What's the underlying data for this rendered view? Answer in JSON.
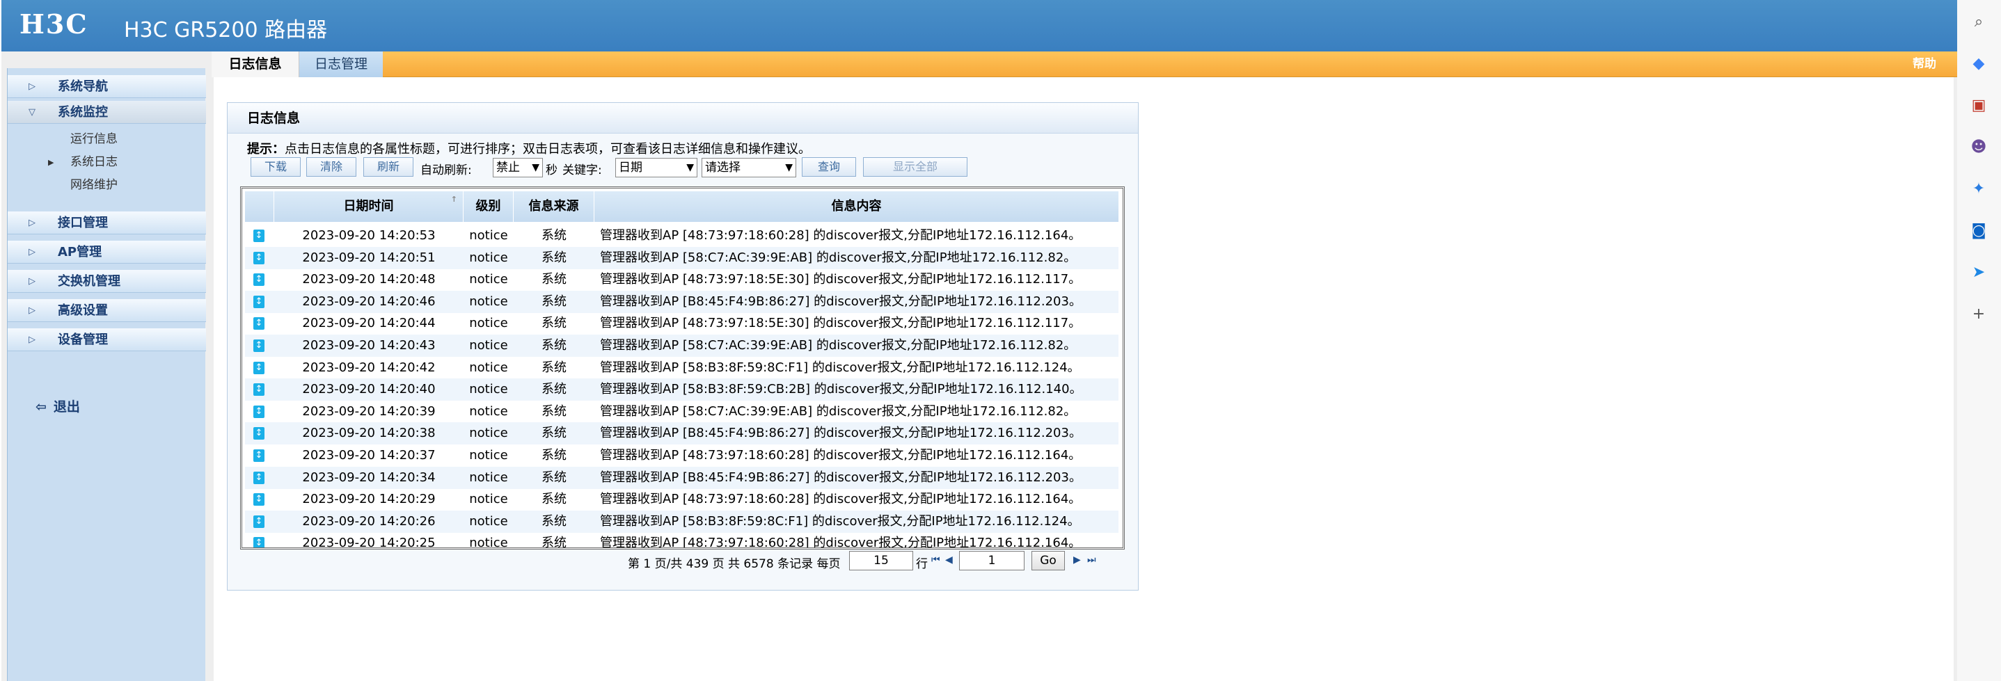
{
  "header": {
    "logo": "H3C",
    "title": "H3C GR5200 路由器"
  },
  "tabs": {
    "log_info": "日志信息",
    "log_manage": "日志管理",
    "help": "帮助"
  },
  "sidebar": {
    "system_nav": "系统导航",
    "system_monitor": "系统监控",
    "sub_items": [
      "运行信息",
      "系统日志",
      "网络维护"
    ],
    "interface_mgmt": "接口管理",
    "ap_mgmt": "AP管理",
    "switch_mgmt": "交换机管理",
    "advanced": "高级设置",
    "device_mgmt": "设备管理",
    "logout": "退出"
  },
  "panel": {
    "title": "日志信息",
    "hint_label": "提示：",
    "hint_text": "点击日志信息的各属性标题，可进行排序；双击日志表项，可查看该日志详细信息和操作建议。"
  },
  "toolbar": {
    "download": "下载",
    "clear": "清除",
    "refresh": "刷新",
    "auto_refresh_label": "自动刷新:",
    "auto_refresh_value": "禁止",
    "seconds_label": "秒",
    "keyword_label": "关键字:",
    "keyword_field": "日期",
    "keyword_value": "请选择",
    "query": "查询",
    "show_all": "显示全部"
  },
  "table": {
    "headers": [
      "日期时间",
      "级别",
      "信息来源",
      "信息内容"
    ],
    "rows": [
      [
        "2023-09-20 14:20:53",
        "notice",
        "系统",
        "管理器收到AP [48:73:97:18:60:28] 的discover报文,分配IP地址172.16.112.164。"
      ],
      [
        "2023-09-20 14:20:51",
        "notice",
        "系统",
        "管理器收到AP [58:C7:AC:39:9E:AB] 的discover报文,分配IP地址172.16.112.82。"
      ],
      [
        "2023-09-20 14:20:48",
        "notice",
        "系统",
        "管理器收到AP [48:73:97:18:5E:30] 的discover报文,分配IP地址172.16.112.117。"
      ],
      [
        "2023-09-20 14:20:46",
        "notice",
        "系统",
        "管理器收到AP [B8:45:F4:9B:86:27] 的discover报文,分配IP地址172.16.112.203。"
      ],
      [
        "2023-09-20 14:20:44",
        "notice",
        "系统",
        "管理器收到AP [48:73:97:18:5E:30] 的discover报文,分配IP地址172.16.112.117。"
      ],
      [
        "2023-09-20 14:20:43",
        "notice",
        "系统",
        "管理器收到AP [58:C7:AC:39:9E:AB] 的discover报文,分配IP地址172.16.112.82。"
      ],
      [
        "2023-09-20 14:20:42",
        "notice",
        "系统",
        "管理器收到AP [58:B3:8F:59:8C:F1] 的discover报文,分配IP地址172.16.112.124。"
      ],
      [
        "2023-09-20 14:20:40",
        "notice",
        "系统",
        "管理器收到AP [58:B3:8F:59:CB:2B] 的discover报文,分配IP地址172.16.112.140。"
      ],
      [
        "2023-09-20 14:20:39",
        "notice",
        "系统",
        "管理器收到AP [58:C7:AC:39:9E:AB] 的discover报文,分配IP地址172.16.112.82。"
      ],
      [
        "2023-09-20 14:20:38",
        "notice",
        "系统",
        "管理器收到AP [B8:45:F4:9B:86:27] 的discover报文,分配IP地址172.16.112.203。"
      ],
      [
        "2023-09-20 14:20:37",
        "notice",
        "系统",
        "管理器收到AP [48:73:97:18:60:28] 的discover报文,分配IP地址172.16.112.164。"
      ],
      [
        "2023-09-20 14:20:34",
        "notice",
        "系统",
        "管理器收到AP [B8:45:F4:9B:86:27] 的discover报文,分配IP地址172.16.112.203。"
      ],
      [
        "2023-09-20 14:20:29",
        "notice",
        "系统",
        "管理器收到AP [48:73:97:18:60:28] 的discover报文,分配IP地址172.16.112.164。"
      ],
      [
        "2023-09-20 14:20:26",
        "notice",
        "系统",
        "管理器收到AP [58:B3:8F:59:8C:F1] 的discover报文,分配IP地址172.16.112.124。"
      ],
      [
        "2023-09-20 14:20:25",
        "notice",
        "系统",
        "管理器收到AP [48:73:97:18:60:28] 的discover报文,分配IP地址172.16.112.164。"
      ]
    ]
  },
  "pager": {
    "info": "第 1 页/共 439 页 共 6578 条记录 每页",
    "per_page": "15",
    "rows_label": "行",
    "page": "1",
    "go": "Go"
  },
  "rail_icons": [
    "search-icon",
    "tag-icon",
    "briefcase-icon",
    "people-icon",
    "copilot-icon",
    "outlook-icon",
    "send-icon",
    "plus-icon"
  ],
  "colors": {
    "header_blue": "#3a7fc0",
    "tab_orange": "#f7a93a",
    "sidebar_blue": "#c9ddf1",
    "row_icon": "#1ab0e8"
  }
}
